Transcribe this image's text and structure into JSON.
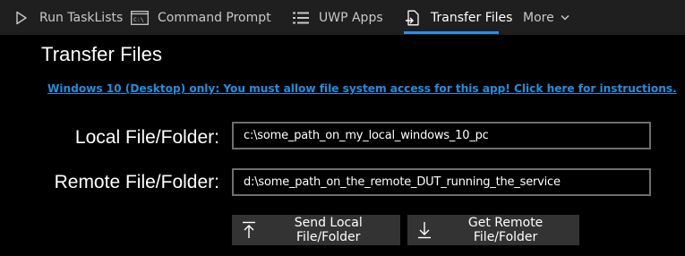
{
  "nav": {
    "items": [
      {
        "label": "Run TaskLists",
        "icon": "play-icon"
      },
      {
        "label": "Command Prompt",
        "icon": "command-prompt-icon"
      },
      {
        "label": "UWP Apps",
        "icon": "list-icon"
      },
      {
        "label": "Transfer Files",
        "icon": "transfer-icon",
        "active": true
      }
    ],
    "more_label": "More",
    "accent_color": "#2f8fe6"
  },
  "page": {
    "title": "Transfer Files",
    "notice": "Windows 10 (Desktop) only: You must allow file system access for this app! Click here for instructions."
  },
  "form": {
    "local_label": "Local File/Folder:",
    "local_value": "c:\\some_path_on_my_local_windows_10_pc",
    "remote_label": "Remote File/Folder:",
    "remote_value": "d:\\some_path_on_the_remote_DUT_running_the_service"
  },
  "actions": {
    "send_label": "Send Local File/Folder",
    "get_label": "Get Remote File/Folder"
  }
}
